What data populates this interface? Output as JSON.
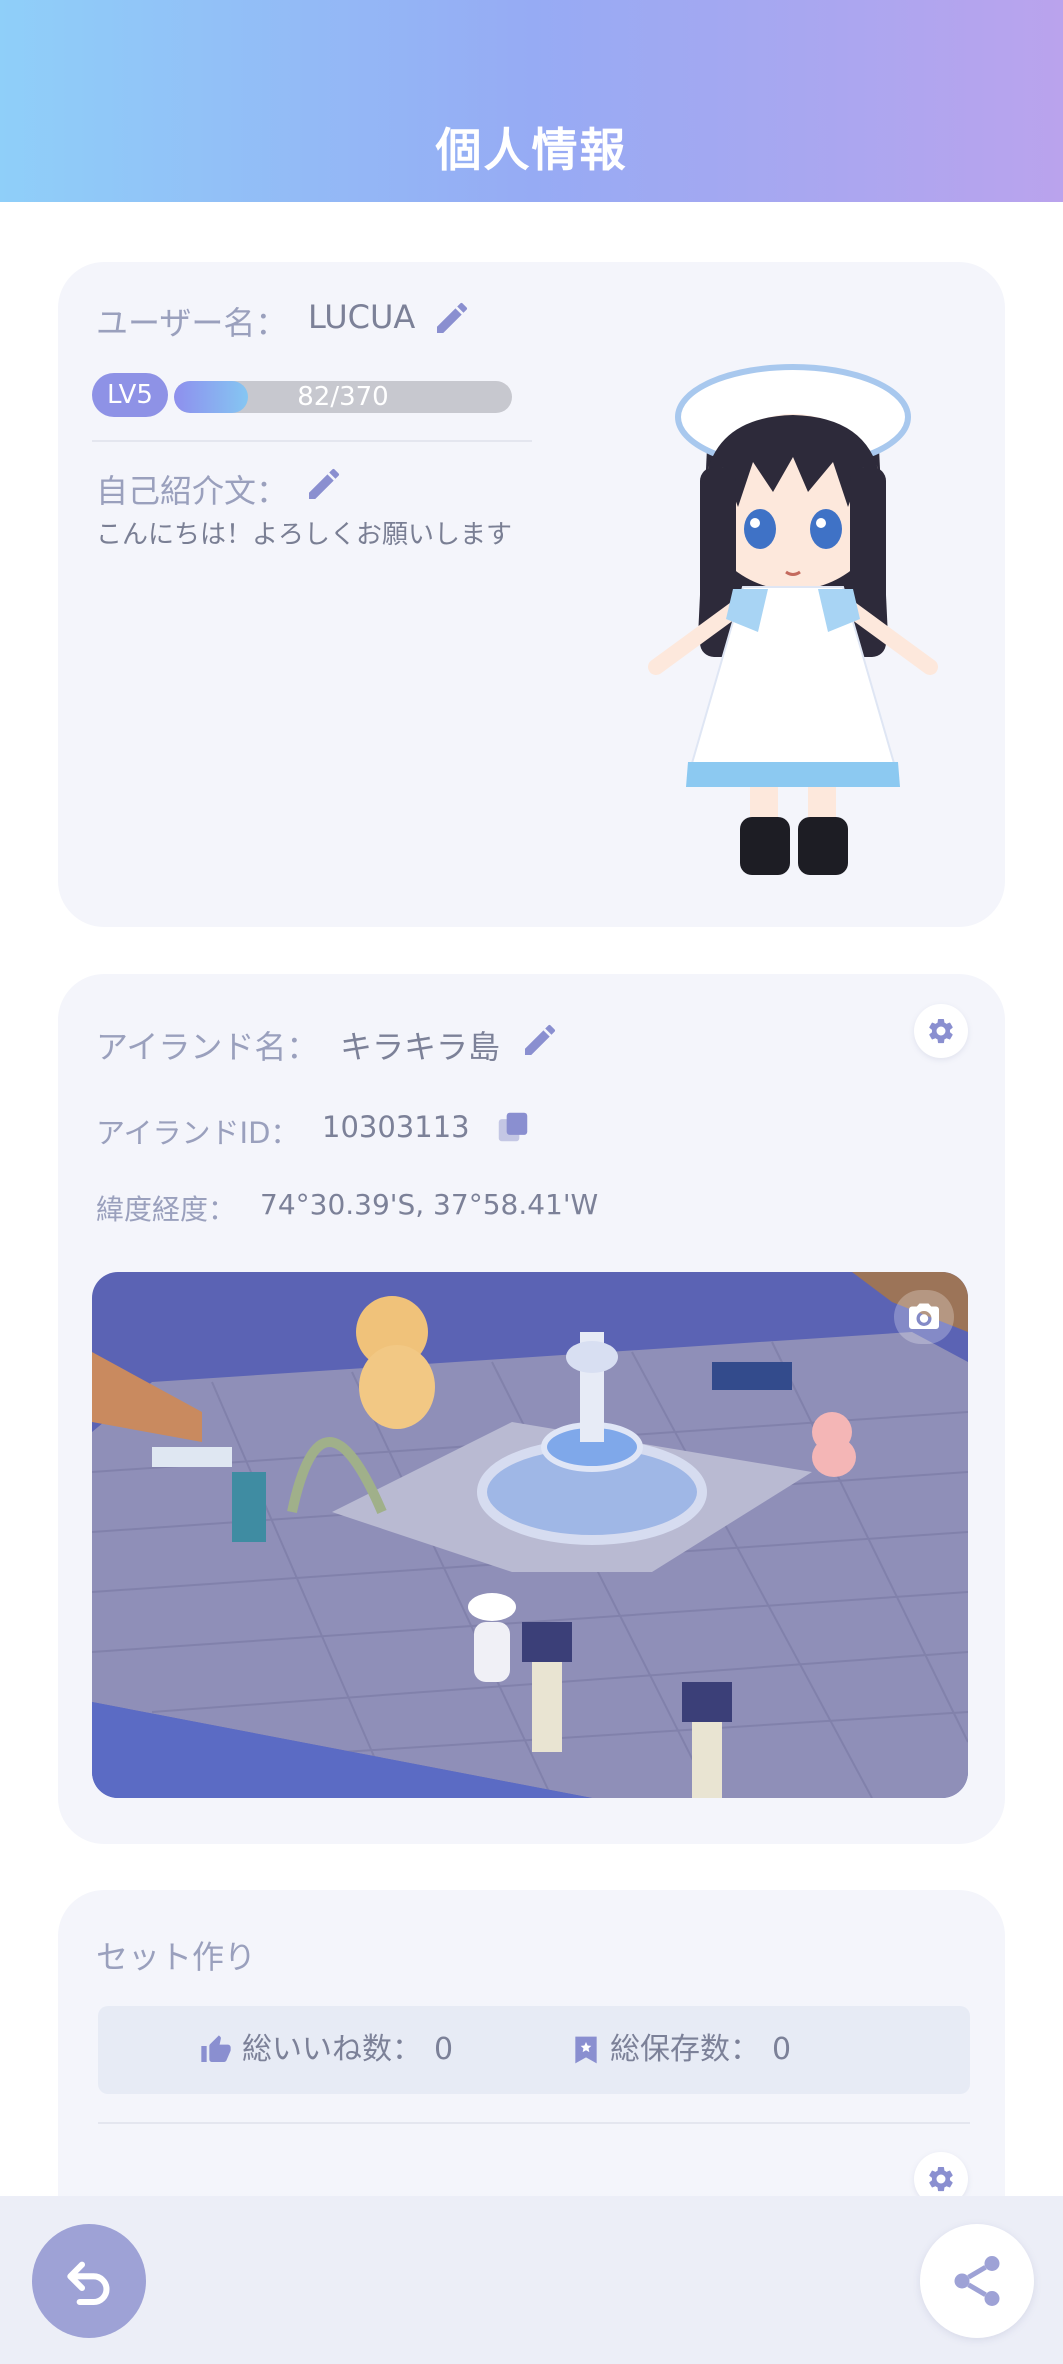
{
  "header": {
    "title": "個人情報"
  },
  "profile": {
    "username_label": "ユーザー名：",
    "username": "LUCUA",
    "level": "LV5",
    "xp_text": "82/370",
    "xp_progress": 0.22,
    "bio_label": "自己紹介文：",
    "bio": "こんにちは！よろしくお願いします"
  },
  "island": {
    "name_label": "アイランド名：",
    "name": "キラキラ島",
    "id_label": "アイランドID：",
    "id": "10303113",
    "coords_label": "緯度経度：",
    "coords": "74°30.39'S, 37°58.41'W"
  },
  "set": {
    "title": "セット作り",
    "likes_label": "総いいね数：",
    "likes": "0",
    "saves_label": "総保存数：",
    "saves": "0"
  },
  "colors": {
    "accent": "#8e92e6",
    "icon": "#8a8fd0",
    "card_bg": "#f4f5fb"
  }
}
